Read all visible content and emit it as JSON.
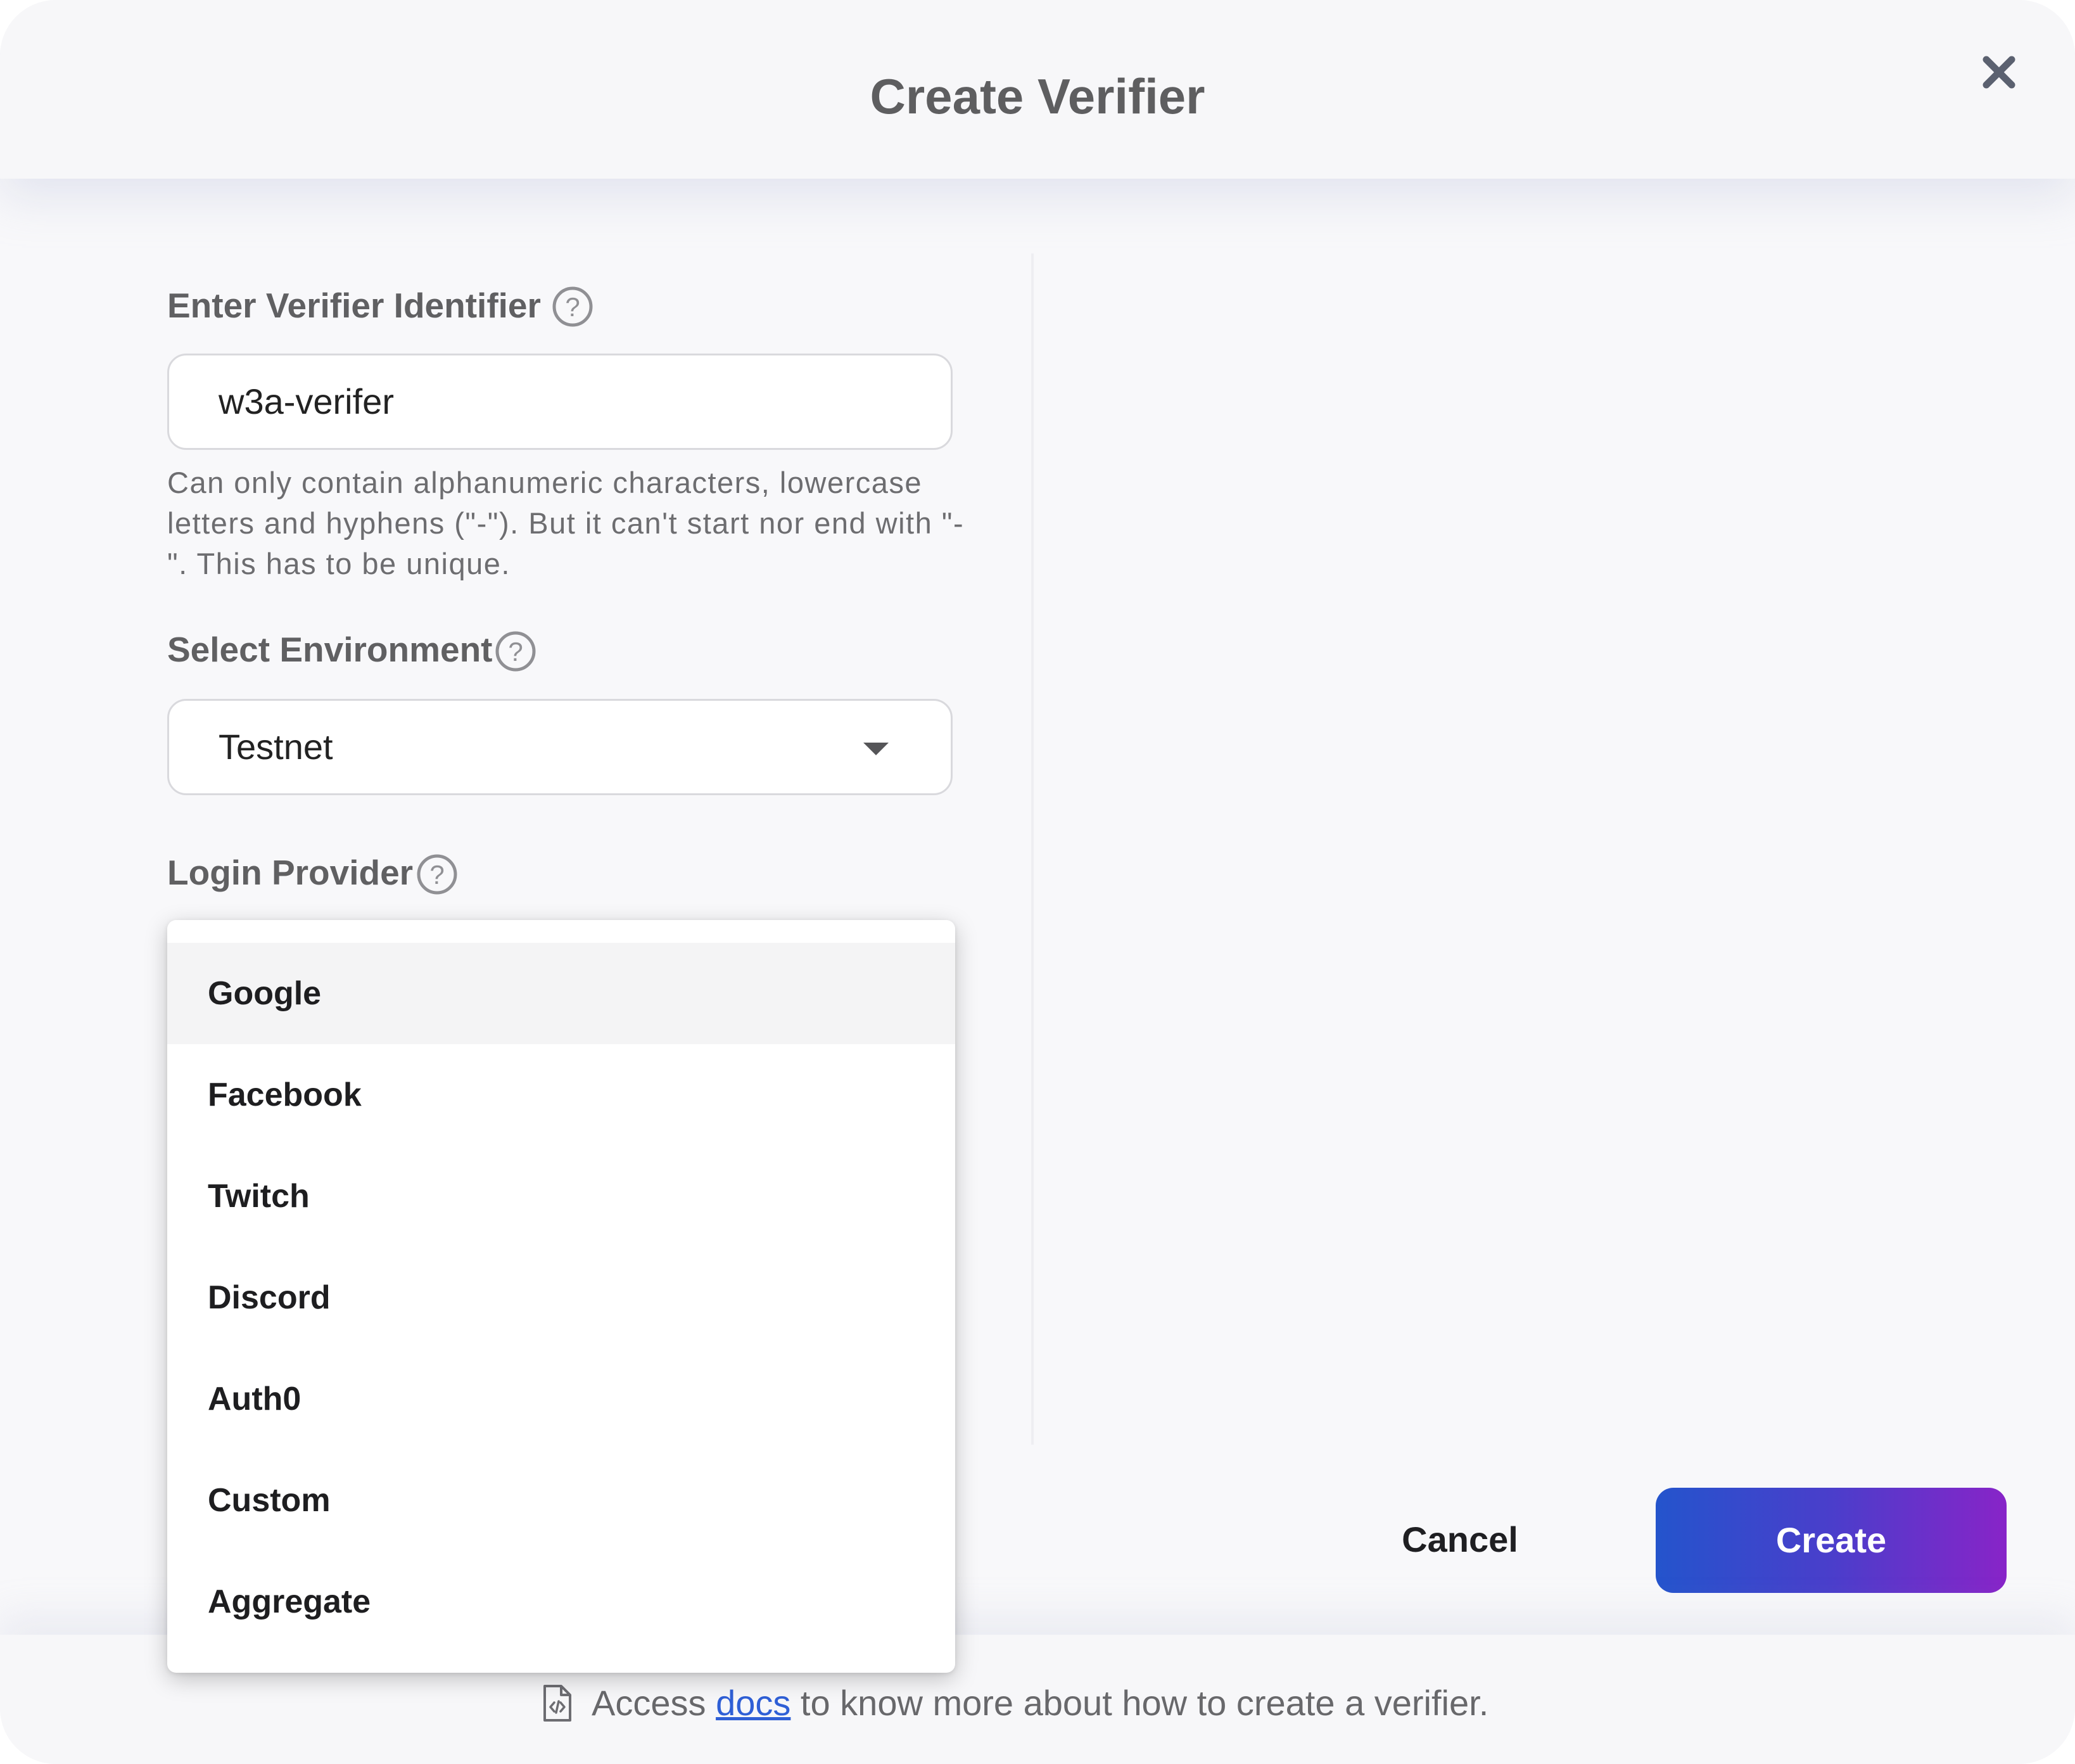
{
  "dialog": {
    "title": "Create Verifier",
    "close_icon": "close-icon"
  },
  "identifier": {
    "label": "Enter Verifier Identifier",
    "value": "w3a-verifer",
    "hint": "Can only contain alphanumeric characters, lowercase letters and hyphens (\"-\"). But it can't start nor end with \"-\". This has to be unique.",
    "help_icon": "help-circle-icon"
  },
  "environment": {
    "label": "Select Environment",
    "value": "Testnet",
    "help_icon": "help-circle-icon",
    "dropdown_icon": "chevron-down-icon"
  },
  "login_provider": {
    "label": "Login Provider",
    "help_icon": "help-circle-icon",
    "options": [
      "Google",
      "Facebook",
      "Twitch",
      "Discord",
      "Auth0",
      "Custom",
      "Aggregate"
    ],
    "highlighted": "Google"
  },
  "actions": {
    "cancel_label": "Cancel",
    "create_label": "Create"
  },
  "footer": {
    "prefix": "Access",
    "link_text": "docs",
    "suffix": "to know more about how to create a verifier.",
    "icon": "document-icon"
  },
  "colors": {
    "create_gradient_start": "#2454cc",
    "create_gradient_end": "#8824c8",
    "link": "#2f5fd6",
    "title": "#5e5e60"
  }
}
